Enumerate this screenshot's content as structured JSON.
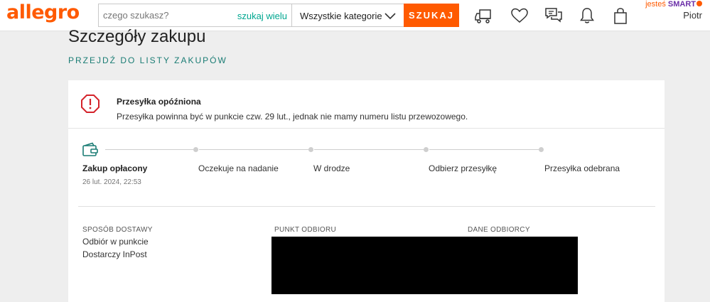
{
  "header": {
    "logo": "allegro",
    "search": {
      "placeholder": "czego szukasz?",
      "multi_label": "szukaj wielu",
      "category": "Wszystkie kategorie",
      "button": "SZUKAJ"
    },
    "icons": [
      "delivery-truck-icon",
      "heart-icon",
      "messages-icon",
      "bell-icon",
      "shopping-bag-icon"
    ],
    "user": {
      "smart_prefix": "jesteś",
      "smart_brand": "SMART",
      "name": "Piotr"
    }
  },
  "page": {
    "title": "Szczegóły zakupu",
    "back_link": "PRZEJDŹ DO LISTY ZAKUPÓW"
  },
  "alert": {
    "title": "Przesyłka opóźniona",
    "message": "Przesyłka powinna być w punkcie czw. 29 lut., jednak nie mamy numeru listu przewozowego."
  },
  "progress": {
    "steps": [
      {
        "label": "Zakup opłacony",
        "date": "26 lut. 2024, 22:53",
        "active": true
      },
      {
        "label": "Oczekuje na nadanie"
      },
      {
        "label": "W drodze"
      },
      {
        "label": "Odbierz przesyłkę"
      },
      {
        "label": "Przesyłka odebrana"
      }
    ]
  },
  "details": {
    "delivery_method_heading": "SPOSÓB DOSTAWY",
    "delivery_method_line1": "Odbiór w punkcie",
    "delivery_method_line2": "Dostarczy InPost",
    "pickup_point_heading": "PUNKT ODBIORU",
    "recipient_heading": "DANE ODBIORCY"
  },
  "colors": {
    "brand": "#ff5a00",
    "link": "#1a7c74",
    "search_multi": "#00a790",
    "smart": "#6b2fa8",
    "alert": "#d4232b",
    "wallet": "#1a7c74"
  }
}
